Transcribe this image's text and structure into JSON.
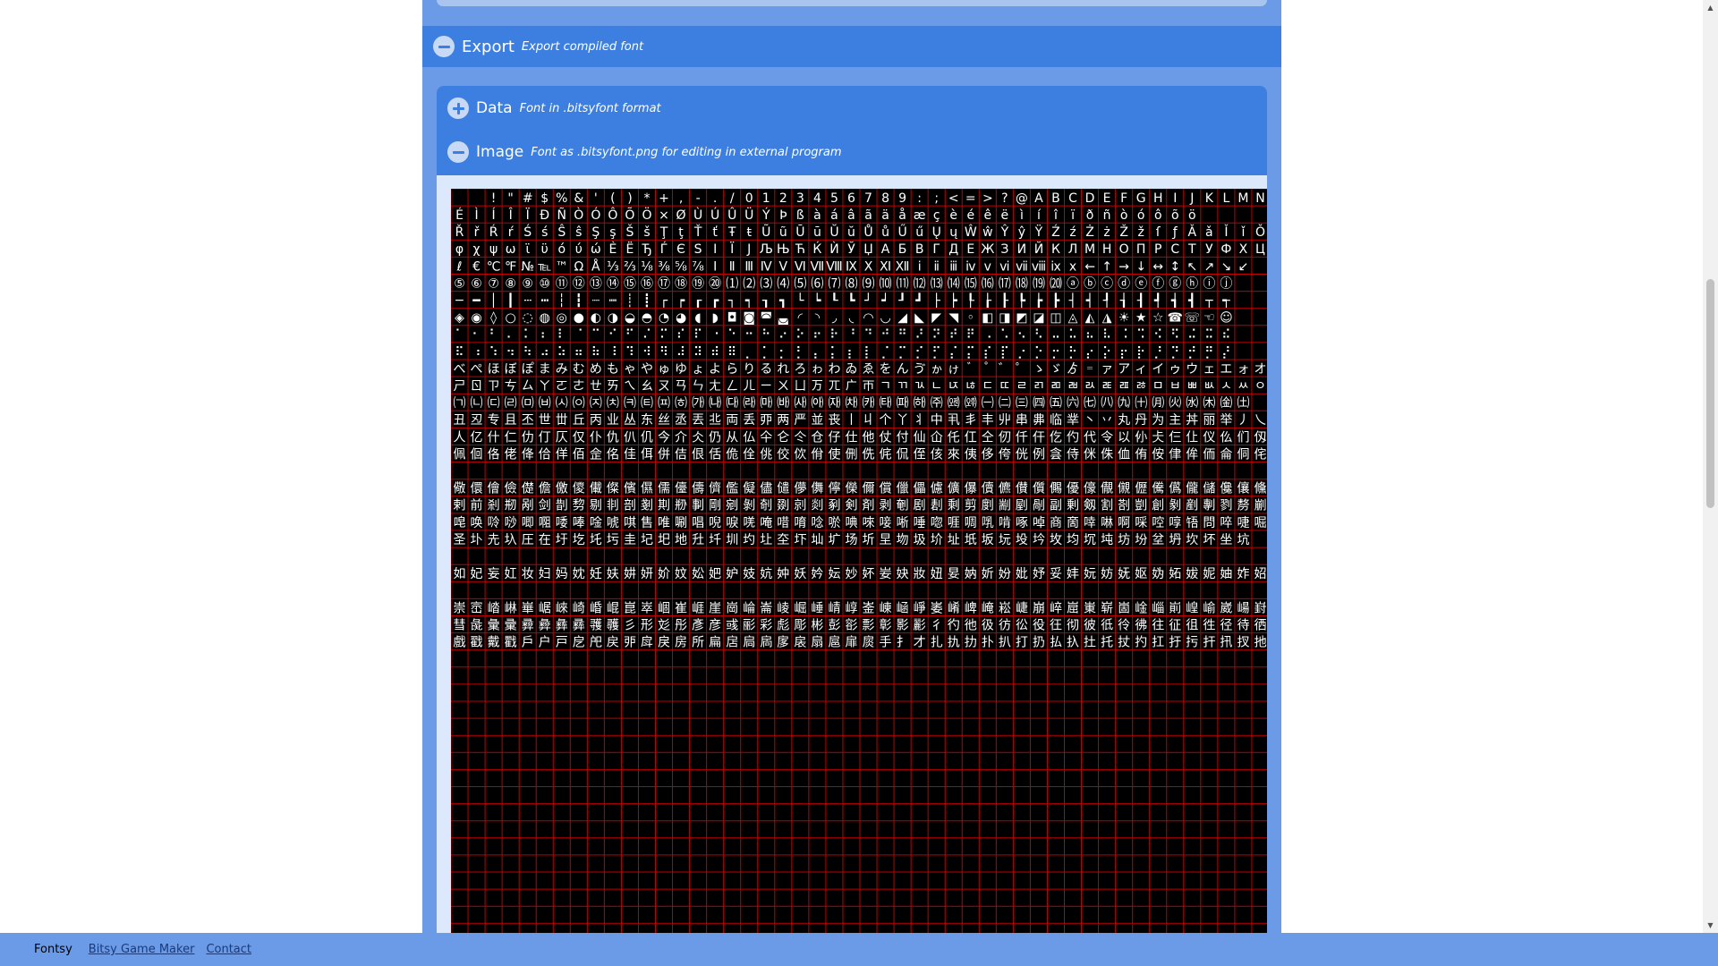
{
  "export": {
    "title": "Export",
    "subtitle": "Export compiled font"
  },
  "data_section": {
    "title": "Data",
    "subtitle": "Font in .bitsyfont format"
  },
  "image_section": {
    "title": "Image",
    "subtitle": "Font as .bitsyfont.png for editing in external program",
    "preview_rows": [
      "  ! \" # $ % & ' ( ) * + , - . / 0 1 2 3 4 5 6 7 8 9 : ; < = > ? @ A B C D E F G H I J K L M N",
      "É Ì Í Î Ï Ð Ñ Ò Ó Ô Õ Ö × Ø Ù Ú Û Ü Ý Þ ß à á â ã ä å æ ç è é ê ë ì í î ï ð ñ ò ó ô õ ö",
      "Ř ř Ŕ ŕ Ś ś Ŝ ŝ Ş ş Š š Ţ ţ Ť ť Ŧ ŧ Ũ ũ Ū ū Ŭ ŭ Ů ů Ű ű Ų ų Ŵ ŵ Ŷ ŷ Ÿ Ź ź Ż ż Ž ž ſ ƒ Ǎ ǎ Ǐ ǐ Ǒ",
      "φ χ ψ ω ϊ ϋ ό ύ ώ Ѐ Ё Ђ Ѓ Є Ѕ І Ї Ј Љ Њ Ћ Ќ Ѝ Ў Џ А Б В Г Д Е Ж З И Й К Л М Н О П Р С Т У Ф Х Ц Ч Ш",
      "ℓ € ℃ ℉ № ℡ ™ Ω Å ⅓ ⅔ ⅛ ⅜ ⅝ ⅞ Ⅰ Ⅱ Ⅲ Ⅳ Ⅴ Ⅵ Ⅶ Ⅷ Ⅸ Ⅹ Ⅺ Ⅻ ⅰ ⅱ ⅲ ⅳ ⅴ ⅵ ⅶ ⅷ ⅸ ⅹ ← ↑ → ↓ ↔ ↕ ↖ ↗ ↘ ↙",
      "⑤ ⑥ ⑦ ⑧ ⑨ ⑩ ⑪ ⑫ ⑬ ⑭ ⑮ ⑯ ⑰ ⑱ ⑲ ⑳ ⑴ ⑵ ⑶ ⑷ ⑸ ⑹ ⑺ ⑻ ⑼ ⑽ ⑾ ⑿ ⒀ ⒁ ⒂ ⒃ ⒄ ⒅ ⒆ ⒇ ⓐ ⓑ ⓒ ⓓ ⓔ ⓕ ⓖ ⓗ ⓘ ⓙ",
      "─ ━ │ ┃ ┄ ┅ ┆ ┇ ┈ ┉ ┊ ┋ ┌ ┍ ┎ ┏ ┐ ┑ ┒ ┓ └ ┕ ┖ ┗ ┘ ┙ ┚ ┛ ├ ┝ ┞ ┟ ┠ ┡ ┢ ┣ ┤ ┥ ┦ ┧ ┨ ┩ ┪ ┫ ┬ ┭",
      "◈ ◉ ◊ ○ ◌ ◍ ◎ ● ◐ ◑ ◒ ◓ ◔ ◕ ◖ ◗ ◘ ◙ ◚ ◛ ◜ ◝ ◞ ◟ ◠ ◡ ◢ ◣ ◤ ◥ ◦ ◧ ◨ ◩ ◪ ◫ ◬ ◭ ◮ ☀ ★ ☆ ☎ ☏ ☜ ☺",
      "⠁ ⠂ ⠃ ⠄ ⠅ ⠆ ⠇ ⠈ ⠉ ⠊ ⠋ ⠌ ⠍ ⠎ ⠏ ⠐ ⠑ ⠒ ⠓ ⠔ ⠕ ⠖ ⠗ ⠘ ⠙ ⠚ ⠛ ⠜ ⠝ ⠞ ⠟ ⠠ ⠡ ⠢ ⠣ ⠤ ⠥ ⠦ ⠧ ⠨ ⠩ ⠪ ⠫ ⠬ ⠭ ⠮",
      "⠯ ⠰ ⠱ ⠲ ⠳ ⠴ ⠵ ⠶ ⠷ ⠸ ⠹ ⠺ ⠻ ⠼ ⠽ ⠾ ⠿ ⡀ ⡁ ⡂ ⡃ ⡄ ⡅ ⡆ ⡇ ⡈ ⡉ ⡊ ⡋ ⡌ ⡍ ⡎ ⡏ ⡐ ⡑ ⡒ ⡓ ⡔ ⡕ ⡖ ⡗ ⡘ ⡙ ⡚ ⡛ ⡜",
      "べ ぺ ほ ぼ ぽ ま み む め も ゃ や ゅ ゆ ょ よ ら り る れ ろ ゎ わ ゐ ゑ を ん ゔ ゕ ゖ ゙ ゚ ゛ ゜ ゝ ゞ ゟ ゠ ァ ア ィ イ ゥ ウ ェ エ ォ オ カ ガ キ ギ ク",
      "ㄕ ㄖ ㄗ ㄘ ㄙ ㄚ ㄛ ㄜ ㄝ ㄞ ㄟ ㄠ ㄡ ㄢ ㄣ ㄤ ㄥ ㄦ ㄧ ㄨ ㄩ ㄪ ㄫ ㄬ ㄭ ㄱ ㄲ ㄳ ㄴ ㄵ ㄶ ㄷ ㄸ ㄹ ㄺ ㄻ ㄼ ㄽ ㄾ ㄿ ㅀ ㅁ ㅂ ㅃ ㅄ ㅅ ㅆ ㅇ",
      "㈀ ㈁ ㈂ ㈃ ㈄ ㈅ ㈆ ㈇ ㈈ ㈉ ㈊ ㈋ ㈌ ㈍ ㈎ ㈏ ㈐ ㈑ ㈒ ㈓ ㈔ ㈕ ㈖ ㈗ ㈘ ㈙ ㈚ ㈛ ㈜ ㈝ ㈞ ㈠ ㈡ ㈢ ㈣ ㈤ ㈥ ㈦ ㈧ ㈨ ㈩ ㈪ ㈫ ㈬ ㈭ ㈮ ㈯",
      "丑 丒 专 且 丕 世 丗 丘 丙 业 丛 东 丝 丞 丟 丠 両 丢 丣 两 严 並 丧 丨 丩 个 丫 丬 中 丮 丯 丰 丱 串 丳 临 丵 丶 丷 丸 丹 为 主 丼 丽 举 丿 乀",
      "人 亿 什 仁 仂 仃 仄 仅 仆 仇 仈 仉 今 介 仌 仍 从 仏 仐 仑 仒 仓 仔 仕 他 仗 付 仙 仚 仛 仜 仝 仞 仟 仠 仡 仢 代 令 以 仦 仧 仨 仩 仪 仫 们 仭",
      "佩 佪 佫 佬 佭 佮 佯 佰 佱 佲 佳 佴 併 佶 佷 佸 佹 佺 佻 佼 佽 佾 使 侀 侁 侂 侃 侄 侅 來 侇 侈 侉 侊 例 侌 侍 侎 侏 侐 侑 侒 侓 侔 侕 侖 侗 侘",
      "儆 儇 儈 儉 儊 儋 儌 儍 儎 儏 儐 儑 儒 儓 儔 儕 儖 儗 儘 儙 儚 儛 儜 儝 儞 償 儠 儡 儢 儣 儤 儥 儦 儧 儨 儩 優 儫 儬 儭 儮 儯 儰 儱 儲 儳 儴 儵",
      "剌 前 剎 剏 剐 剑 剒 剓 剔 剕 剖 剗 剘 剙 剚 剛 剜 剝 剞 剟 剠 剡 剢 剣 剤 剥 剦 剧 剨 剩 剪 剫 剬 剭 剮 副 剰 剱 割 剳 剴 創 剶 剷 剸 剹 剺 剻",
      "唣 唤 唥 唦 唧 唨 唩 唪 唫 唬 唭 售 唯 唰 唱 唲 唳 唴 唵 唶 唷 唸 唹 唺 唻 唼 唽 唾 唿 啀 啁 啂 啃 啄 啅 商 啇 啈 啉 啊 啋 啌 啍 啎 問 啐 啑 啒",
      "圣 圤 圥 圦 圧 在 圩 圪 圫 圬 圭 圮 圯 地 圱 圲 圳 圴 圵 圶 圷 圸 圹 场 圻 圼 圽 圾 圿 址 坁 坂 坃 坄 坅 坆 均 坈 坉 坊 坋 坌 坍 坎 坏 坐 坑",
      "如 妃 妄 妅 妆 妇 妈 妉 妊 妋 妌 妍 妎 妏 妐 妑 妒 妓 妔 妕 妖 妗 妘 妙 妚 妛 妜 妝 妞 妟 妠 妡 妢 妣 妤 妥 妦 妧 妨 妩 妪 妫 妬 妭 妮 妯 妰 妱",
      "崇 崈 崉 崊 崋 崌 崍 崎 崏 崐 崑 崒 崓 崔 崕 崖 崗 崘 崙 崚 崛 崜 崝 崞 崟 崠 崡 崢 崣 崤 崥 崦 崧 崨 崩 崪 崫 崬 崭 崮 崯 崰 崱 崲 崳 崴 崵 崶",
      "彗 彘 彙 彚 彛 彜 彝 彞 彟 彠 彡 形 彣 彤 彥 彦 彧 彨 彩 彪 彫 彬 彭 彮 彯 彰 影 彲 彳 彴 彵 彶 彷 彸 役 彺 彻 彼 彽 彾 彿 往 征 徂 徃 径 待 徆",
      "戲 戳 戴 戵 戶 户 戸 戹 戺 戻 戼 戽 戾 房 所 扁 扂 扃 扄 扅 扆 扇 扈 扉 扊 手 扌 才 扎 扏 扐 扑 扒 打 扔 払 扖 扗 托 扙 扚 扛 扜 扝 扞 扟 扠 扡"
    ]
  },
  "footer": {
    "brand": "Fontsy",
    "links": [
      "Bitsy Game Maker",
      "Contact"
    ]
  }
}
